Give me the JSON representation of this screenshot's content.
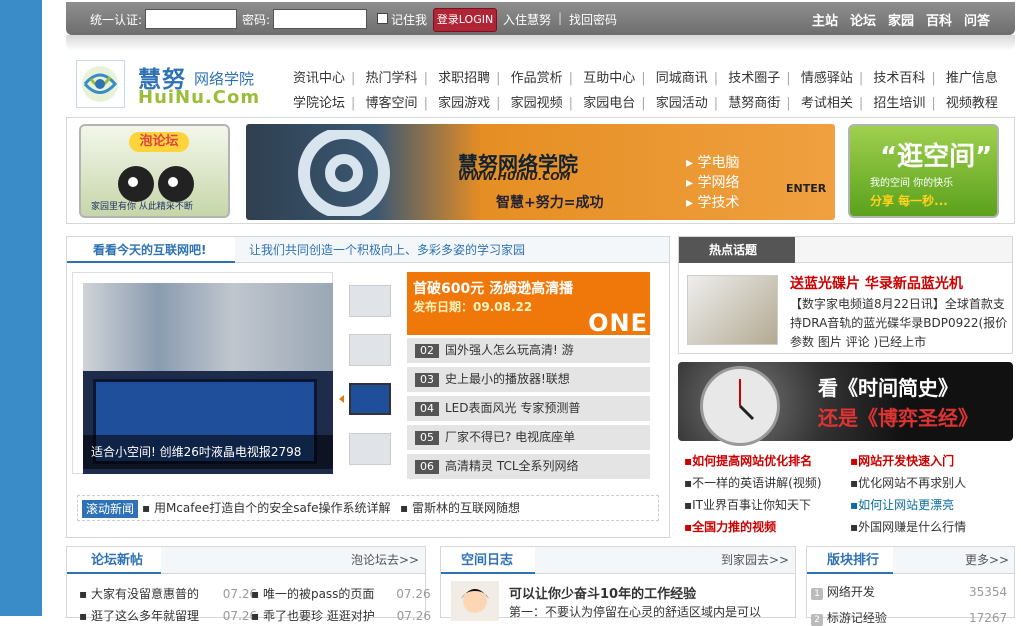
{
  "login": {
    "user_label": "统一认证:",
    "user_value": "",
    "pass_label": "密码:",
    "pass_value": "",
    "remember_label": "记住我",
    "login_button": "登录LOGIN",
    "join_link": "入住慧努",
    "find_pwd_link": "找回密码"
  },
  "topnav": [
    "主站",
    "论坛",
    "家园",
    "百科",
    "问答"
  ],
  "logo": {
    "cn": "慧努",
    "cn_sub": "网络学院",
    "en": "HuiNu.Com"
  },
  "nav_row1": [
    "资讯中心",
    "热门学科",
    "求职招聘",
    "作品赏析",
    "互助中心",
    "同城商讯",
    "技术圈子",
    "情感驿站",
    "技术百科",
    "推广信息"
  ],
  "nav_row2": [
    "学院论坛",
    "博客空间",
    "家园游戏",
    "家园视频",
    "家园电台",
    "家园活动",
    "慧努商街",
    "考试相关",
    "招生培训",
    "视频教程"
  ],
  "banners": {
    "left": {
      "title": "泡论坛",
      "sub": "家园里有你 从此精采不断"
    },
    "center": {
      "title": "慧努网络学院",
      "url": "WWW.HUINU.COM",
      "slogan": "智慧+努力=成功",
      "items": [
        "学电脑",
        "学网络",
        "学技术"
      ],
      "enter": "ENTER"
    },
    "right": {
      "title": "“逛空间”",
      "sub": "我的空间  你的快乐",
      "sub2": "分享 每一秒..."
    }
  },
  "main": {
    "tab_active": "看看今天的互联网吧!",
    "tab_slogan": "让我们共同创造一个积极向上、多彩多姿的学习家园",
    "photo_caption": "适合小空间! 创维26吋液晶电视报2798",
    "headline_title": "首破600元  汤姆逊高清播",
    "headline_date": "发布日期：09.08.22",
    "headline_brand": "ONE",
    "news": [
      {
        "num": "02",
        "text": "国外强人怎么玩高清! 游"
      },
      {
        "num": "03",
        "text": "史上最小的播放器!联想"
      },
      {
        "num": "04",
        "text": "LED表面风光 专家预测普"
      },
      {
        "num": "05",
        "text": "厂家不得已? 电视底座单"
      },
      {
        "num": "06",
        "text": "高清精灵 TCL全系列网络"
      }
    ],
    "scroll_tag": "滚动新闻",
    "scroll_items": [
      "用Mcafee打造自个的安全safe操作系统详解",
      "雷斯林的互联网随想"
    ]
  },
  "hot": {
    "title": "热点话题",
    "headline": "送蓝光碟片 华录新品蓝光机",
    "body": "【数字家电频道8月22日讯】全球首款支持DRA音轨的蓝光碟华录BDP0922(报价 参数 图片 评论 )已经上市",
    "banner_t1": "看《时间简史》",
    "banner_t2": "还是《博弈圣经》"
  },
  "links": [
    [
      "如何提高网站优化排名",
      "网站开发快速入门"
    ],
    [
      "不一样的英语讲解(视频)",
      "优化网站不再求别人"
    ],
    [
      "IT业界百事让你知天下",
      "如何让网站更漂亮"
    ],
    [
      "全国力推的视频",
      "外国网赚是什么行情"
    ]
  ],
  "forum": {
    "title": "论坛新帖",
    "more": "泡论坛去>>",
    "rows": [
      {
        "a": "大家有没留意惠普的",
        "ad": "07.26",
        "b": "唯一的被pass的页面",
        "bd": "07.26"
      },
      {
        "a": "逛了这么多年就留理",
        "ad": "07.26",
        "b": "乖了也要珍 逛逛对护",
        "bd": "07.26"
      }
    ]
  },
  "space": {
    "title": "空间日志",
    "more": "到家园去>>",
    "post_title": "可以让你少奋斗10年的工作经验",
    "post_body": "第一：不要认为停留在心灵的舒适区域内是可以"
  },
  "rank": {
    "title": "版块排行",
    "more": "更多>>",
    "rows": [
      {
        "n": "1",
        "name": "网络开发",
        "count": "35354"
      },
      {
        "n": "2",
        "name": "标游记经验",
        "count": "17267"
      }
    ]
  }
}
